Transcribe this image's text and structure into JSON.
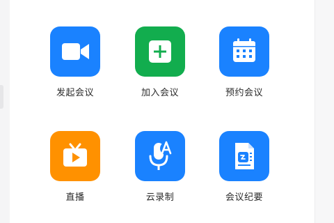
{
  "actions": [
    {
      "label": "发起会议",
      "icon": "video-camera-icon",
      "color": "#1a82ff"
    },
    {
      "label": "加入会议",
      "icon": "plus-icon",
      "color": "#12ad4e"
    },
    {
      "label": "预约会议",
      "icon": "calendar-icon",
      "color": "#1a82ff"
    },
    {
      "label": "直播",
      "icon": "tv-play-icon",
      "color": "#ff9100"
    },
    {
      "label": "云录制",
      "icon": "mic-transcribe-icon",
      "color": "#1a82ff"
    },
    {
      "label": "会议纪要",
      "icon": "meeting-notes-icon",
      "color": "#1a82ff"
    }
  ]
}
